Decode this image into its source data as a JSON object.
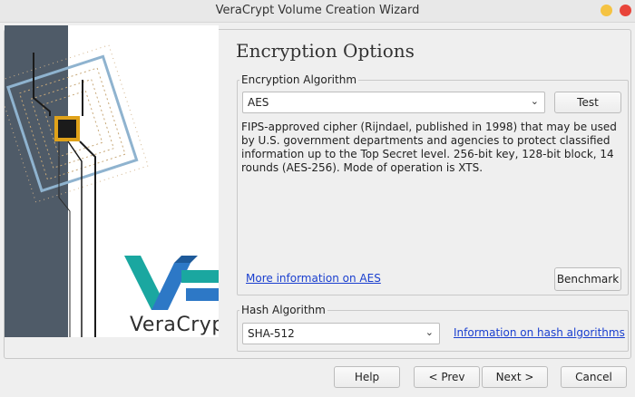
{
  "window": {
    "title": "VeraCrypt Volume Creation Wizard"
  },
  "page": {
    "title": "Encryption Options"
  },
  "encryption": {
    "group_label": "Encryption Algorithm",
    "selected": "AES",
    "test_label": "Test",
    "description": "FIPS-approved cipher (Rijndael, published in 1998) that may be used by U.S. government departments and agencies to protect classified information up to the Top Secret level. 256-bit key, 128-bit block, 14 rounds (AES-256). Mode of operation is XTS.",
    "more_info_link": "More information on AES",
    "benchmark_label": "Benchmark"
  },
  "hash": {
    "group_label": "Hash Algorithm",
    "selected": "SHA-512",
    "info_link": "Information on hash algorithms"
  },
  "buttons": {
    "help": "Help",
    "prev": "< Prev",
    "next": "Next >",
    "cancel": "Cancel"
  },
  "brand": {
    "logo_text": "VeraCrypt"
  },
  "colors": {
    "link": "#1a3fcf",
    "logo_teal": "#1aa7a0",
    "logo_blue": "#2d78c6",
    "chip_gold": "#e0a21a"
  }
}
